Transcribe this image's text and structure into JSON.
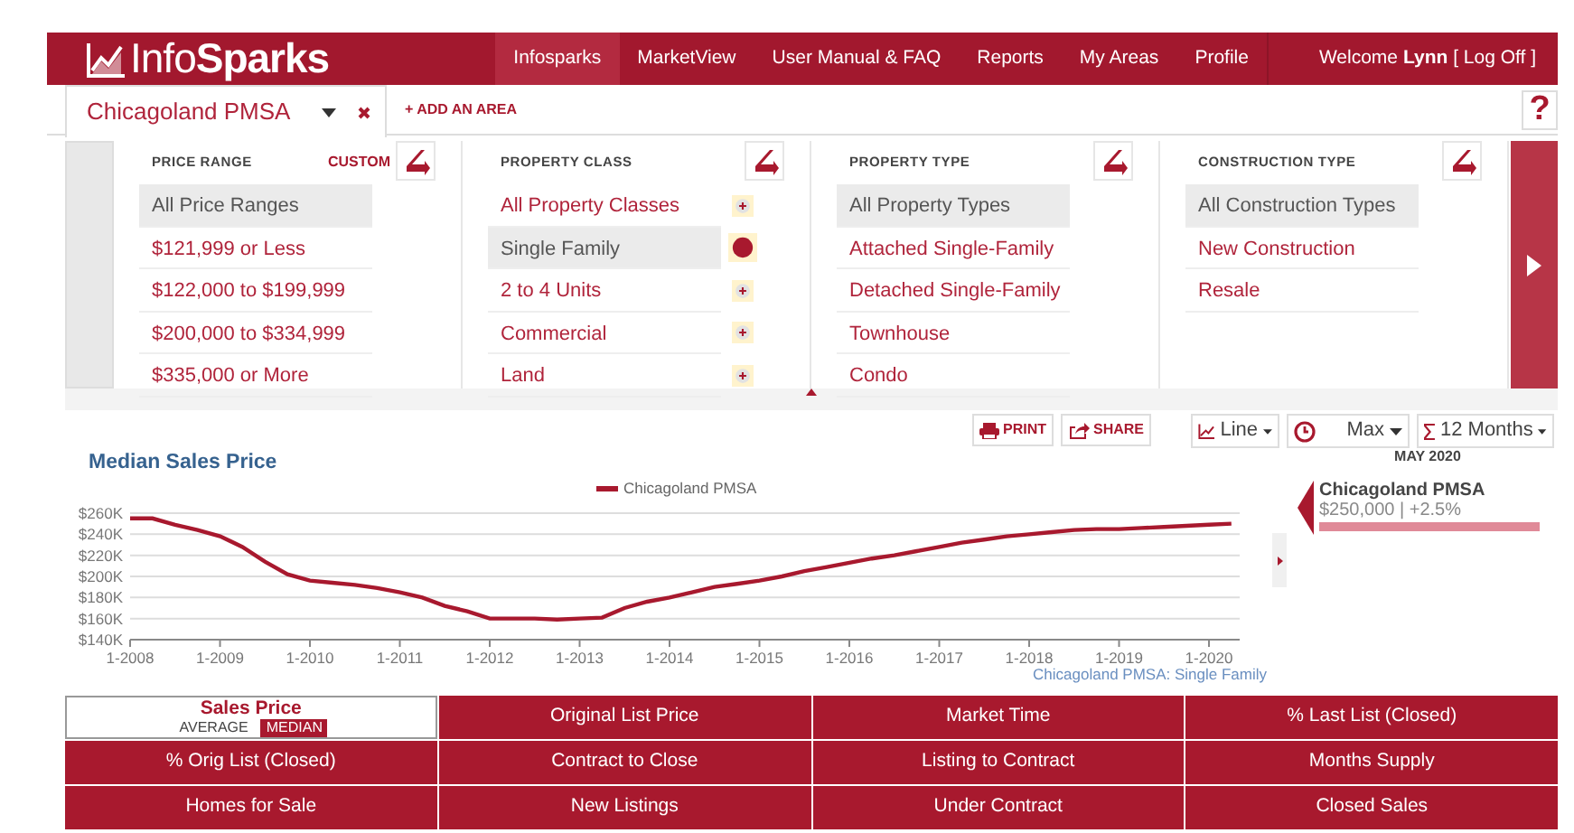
{
  "header": {
    "logo": "Info**Sparks**",
    "nav": [
      {
        "label": "Infosparks",
        "selected": true
      },
      {
        "label": "MarketView",
        "selected": false
      },
      {
        "label": "User Manual & FAQ",
        "selected": false
      },
      {
        "label": "Reports",
        "selected": false
      },
      {
        "label": "My Areas",
        "selected": false
      },
      {
        "label": "Profile",
        "selected": false
      }
    ],
    "welcome": "Welcome **Lynn** [ Log Off ]"
  },
  "area_tabs": [
    {
      "label": "Chicagoland PMSA",
      "selected": true
    }
  ],
  "add_area": "+ ADD AN AREA",
  "help": "?",
  "filters": [
    {
      "title": "PRICE RANGE",
      "custom": "CUSTOM",
      "kind": "plain",
      "items": [
        {
          "label": "All Price Ranges",
          "selected": true
        },
        {
          "label": "$121,999 or Less",
          "selected": false
        },
        {
          "label": "$122,000 to $199,999",
          "selected": false
        },
        {
          "label": "$200,000 to $334,999",
          "selected": false
        },
        {
          "label": "$335,000 or More",
          "selected": false
        }
      ]
    },
    {
      "title": "PROPERTY CLASS",
      "kind": "addable",
      "items": [
        {
          "label": "All Property Classes",
          "selected": false
        },
        {
          "label": "Single Family",
          "selected": true
        },
        {
          "label": "2 to 4 Units",
          "selected": false
        },
        {
          "label": "Commercial",
          "selected": false
        },
        {
          "label": "Land",
          "selected": false
        }
      ]
    },
    {
      "title": "PROPERTY TYPE",
      "kind": "plain",
      "items": [
        {
          "label": "All Property Types",
          "selected": true
        },
        {
          "label": "Attached Single-Family",
          "selected": false
        },
        {
          "label": "Detached Single-Family",
          "selected": false
        },
        {
          "label": "Townhouse",
          "selected": false
        },
        {
          "label": "Condo",
          "selected": false
        }
      ]
    },
    {
      "title": "CONSTRUCTION TYPE",
      "kind": "plain",
      "items": [
        {
          "label": "All Construction Types",
          "selected": true
        },
        {
          "label": "New Construction",
          "selected": false
        },
        {
          "label": "Resale",
          "selected": false
        }
      ]
    }
  ],
  "toolbar": {
    "print": "PRINT",
    "share": "SHARE",
    "chart_type": "Line",
    "range": "Max",
    "period": "12 Months"
  },
  "chart": {
    "footnote": "Chicagoland PMSA: Single Family",
    "chart_data": {
      "type": "line",
      "title": "Median Sales Price",
      "categories": [
        "1-2008",
        null,
        null,
        null,
        "1-2009",
        null,
        null,
        null,
        "1-2010",
        null,
        null,
        null,
        "1-2011",
        null,
        null,
        null,
        "1-2012",
        null,
        null,
        null,
        "1-2013",
        null,
        null,
        null,
        "1-2014",
        null,
        null,
        null,
        "1-2015",
        null,
        null,
        null,
        "1-2016",
        null,
        null,
        null,
        "1-2017",
        null,
        null,
        null,
        "1-2018",
        null,
        null,
        null,
        "1-2019",
        null,
        null,
        null,
        "1-2020",
        null
      ],
      "series": [
        {
          "name": "Chicagoland PMSA",
          "color": "#a8192e",
          "values": [
            255,
            255,
            249,
            244,
            238,
            228,
            214,
            202,
            196,
            194,
            192,
            189,
            185,
            180,
            172,
            167,
            160,
            160,
            160,
            159,
            160,
            161,
            170,
            176,
            180,
            185,
            190,
            193,
            196,
            200,
            205,
            209,
            213,
            217,
            220,
            224,
            228,
            232,
            235,
            238,
            240,
            242,
            244,
            245,
            245,
            246,
            247,
            248,
            249,
            250
          ]
        }
      ],
      "ylim": [
        140,
        260
      ],
      "grid": true,
      "yticks": [
        {
          "value": 140,
          "label": "$140K"
        },
        {
          "value": 160,
          "label": "$160K"
        },
        {
          "value": 180,
          "label": "$180K"
        },
        {
          "value": 200,
          "label": "$200K"
        },
        {
          "value": 220,
          "label": "$220K"
        },
        {
          "value": 240,
          "label": "$240K"
        },
        {
          "value": 260,
          "label": "$260K"
        }
      ]
    }
  },
  "detail": {
    "date": "MAY 2020",
    "name": "Chicagoland PMSA",
    "value": "$250,000 | +2.5%"
  },
  "metrics": [
    {
      "label": "Sales Price",
      "selected": true,
      "options": [
        {
          "label": "AVERAGE",
          "selected": false
        },
        {
          "label": "MEDIAN",
          "selected": true
        }
      ]
    },
    {
      "label": "Original List Price",
      "selected": false
    },
    {
      "label": "Market Time",
      "selected": false
    },
    {
      "label": "% Last List (Closed)",
      "selected": false
    },
    {
      "label": "% Orig List (Closed)",
      "selected": false
    },
    {
      "label": "Contract to Close",
      "selected": false
    },
    {
      "label": "Listing to Contract",
      "selected": false
    },
    {
      "label": "Months Supply",
      "selected": false
    },
    {
      "label": "Homes for Sale",
      "selected": false
    },
    {
      "label": "New Listings",
      "selected": false
    },
    {
      "label": "Under Contract",
      "selected": false
    },
    {
      "label": "Closed Sales",
      "selected": false
    }
  ]
}
